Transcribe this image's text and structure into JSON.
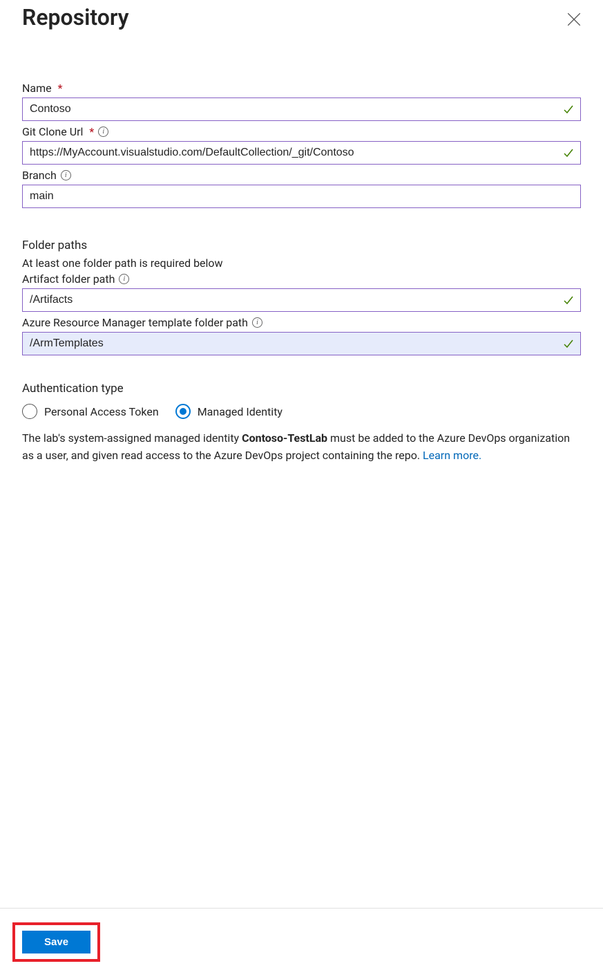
{
  "header": {
    "title": "Repository"
  },
  "fields": {
    "name": {
      "label": "Name",
      "value": "Contoso"
    },
    "giturl": {
      "label": "Git Clone Url",
      "value": "https://MyAccount.visualstudio.com/DefaultCollection/_git/Contoso"
    },
    "branch": {
      "label": "Branch",
      "value": "main"
    }
  },
  "folderSection": {
    "title": "Folder paths",
    "helper": "At least one folder path is required below",
    "artifact": {
      "label": "Artifact folder path",
      "value": "/Artifacts"
    },
    "arm": {
      "label": "Azure Resource Manager template folder path",
      "value": "/ArmTemplates"
    }
  },
  "auth": {
    "title": "Authentication type",
    "options": {
      "pat": "Personal Access Token",
      "mi": "Managed Identity"
    },
    "selected": "mi",
    "note_pre": "The lab's system-assigned managed identity ",
    "note_bold": "Contoso-TestLab",
    "note_post": " must be added to the Azure DevOps organization as a user, and given read access to the Azure DevOps project containing the repo. ",
    "learn": "Learn more."
  },
  "footer": {
    "save": "Save"
  }
}
